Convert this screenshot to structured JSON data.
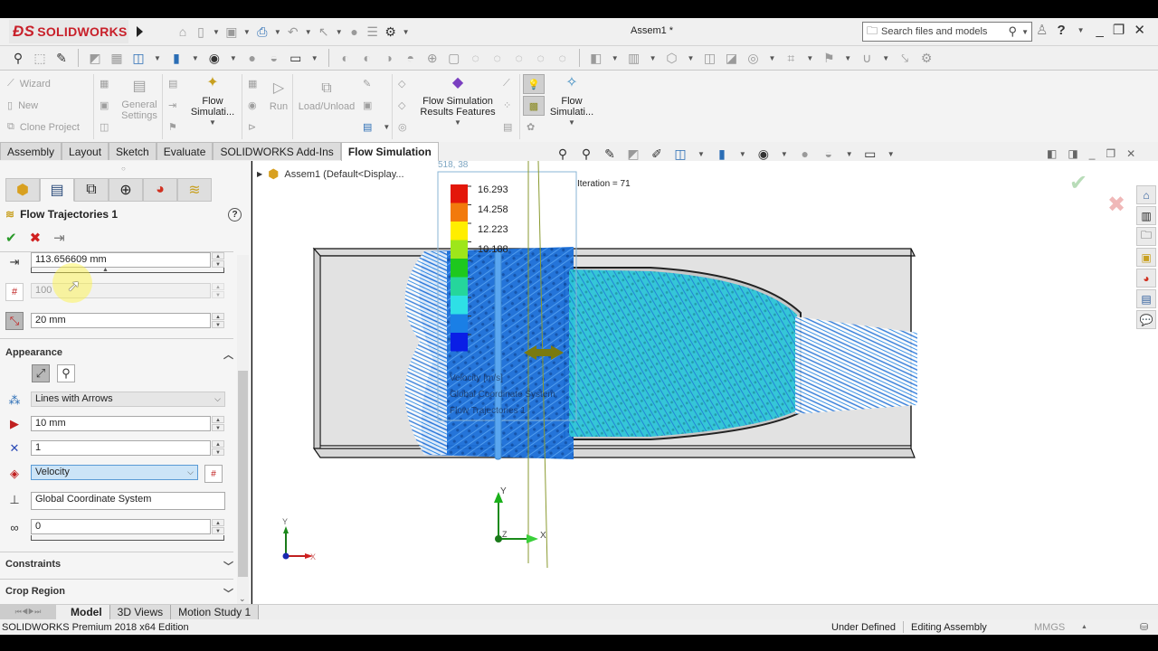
{
  "app": {
    "brand": "SOLIDWORKS",
    "document_title": "Assem1 *",
    "search_placeholder": "Search files and models"
  },
  "ribbon": {
    "small_buttons": [
      "Wizard",
      "New",
      "Clone Project"
    ],
    "general_settings": "General Settings",
    "flow_sim_1": "Flow Simulati...",
    "run": "Run",
    "load_unload": "Load/Unload",
    "results_features": "Flow Simulation Results Features",
    "flow_sim_2": "Flow Simulati..."
  },
  "command_tabs": [
    {
      "label": "Assembly",
      "active": false
    },
    {
      "label": "Layout",
      "active": false
    },
    {
      "label": "Sketch",
      "active": false
    },
    {
      "label": "Evaluate",
      "active": false
    },
    {
      "label": "SOLIDWORKS Add-Ins",
      "active": false
    },
    {
      "label": "Flow Simulation",
      "active": true
    }
  ],
  "property_manager": {
    "title": "Flow Trajectories 1",
    "help": "?",
    "fields": {
      "offset": "113.656609 mm",
      "number_points": "100",
      "spacing": "20 mm"
    },
    "appearance": {
      "header": "Appearance",
      "style": "Lines with Arrows",
      "arrow_size": "10 mm",
      "width": "1",
      "color_by": "Velocity",
      "coordinate_system": "Global Coordinate System",
      "transparency": "0"
    },
    "sections": {
      "constraints": "Constraints",
      "crop_region": "Crop Region"
    }
  },
  "viewport": {
    "tree_item": "Assem1  (Default<Display...",
    "coords": "518, 38",
    "iteration": "Iteration = 71",
    "legend": {
      "values": [
        "16.293",
        "14.258",
        "12.223",
        "10.188"
      ],
      "title": "Velocity [m/s]",
      "coord_system": "Global Coordinate System",
      "plot_name": "Flow Trajectories 1",
      "colors": [
        "#e3170a",
        "#f27a0c",
        "#ffee00",
        "#9ee61a",
        "#1ec81e",
        "#25d69c",
        "#2ee0e6",
        "#1a7fe6",
        "#0a1ee6"
      ]
    },
    "triad": {
      "x": "X",
      "y": "Y",
      "z": "Z"
    }
  },
  "bottom_tabs": [
    {
      "label": "Model",
      "active": true
    },
    {
      "label": "3D Views",
      "active": false
    },
    {
      "label": "Motion Study 1",
      "active": false
    }
  ],
  "status": {
    "edition": "SOLIDWORKS Premium 2018 x64 Edition",
    "definition": "Under Defined",
    "mode": "Editing Assembly",
    "units": "MMGS"
  }
}
